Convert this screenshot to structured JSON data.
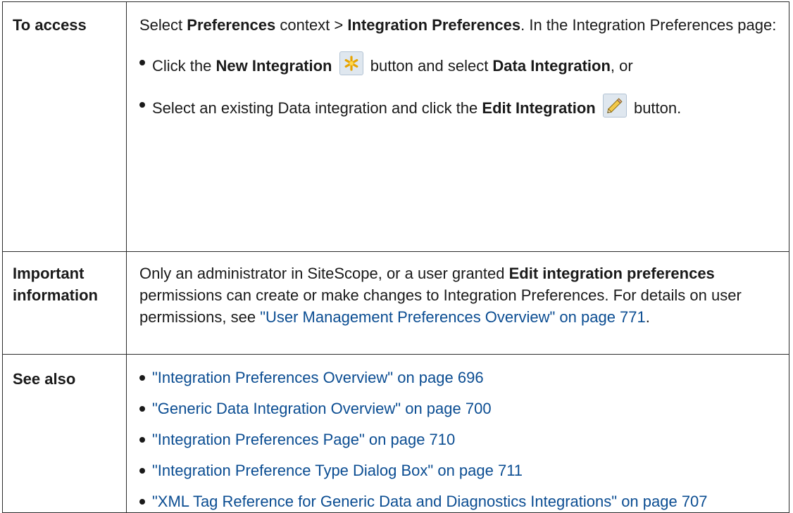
{
  "access": {
    "heading": "To access",
    "intro_pre": "Select ",
    "intro_b1": "Preferences",
    "intro_mid": " context > ",
    "intro_b2": "Integration Preferences",
    "intro_post": ". In the Integration Preferences page:",
    "item1": {
      "pre": "Click the ",
      "bold1": "New Integration",
      "icon": "new-integration-icon",
      "mid": " button and select ",
      "bold2": "Data Integration",
      "post": ", or"
    },
    "item2": {
      "pre": "Select an existing Data integration and click the ",
      "bold": "Edit Integration",
      "icon": "edit-integration-icon",
      "post": " button."
    }
  },
  "important": {
    "heading": "Important information",
    "pre": "Only an administrator in SiteScope, or a user granted ",
    "bold": "Edit integration preferences",
    "mid": " permissions can create or make changes to Integration Preferences. For details on user permissions, see ",
    "link": "\"User Management Preferences Overview\" on page 771",
    "post": "."
  },
  "see_also": {
    "heading": "See also",
    "links": [
      "\"Integration Preferences Overview\" on page 696",
      "\"Generic Data Integration Overview\" on page 700",
      "\"Integration Preferences Page\" on page 710",
      "\"Integration Preference Type Dialog Box\" on page 711",
      "\"XML Tag Reference for Generic Data and Diagnostics Integrations\" on page 707"
    ]
  },
  "colors": {
    "link": "#0b4d92",
    "border": "#2b2b2b",
    "text": "#1a1a1a"
  }
}
